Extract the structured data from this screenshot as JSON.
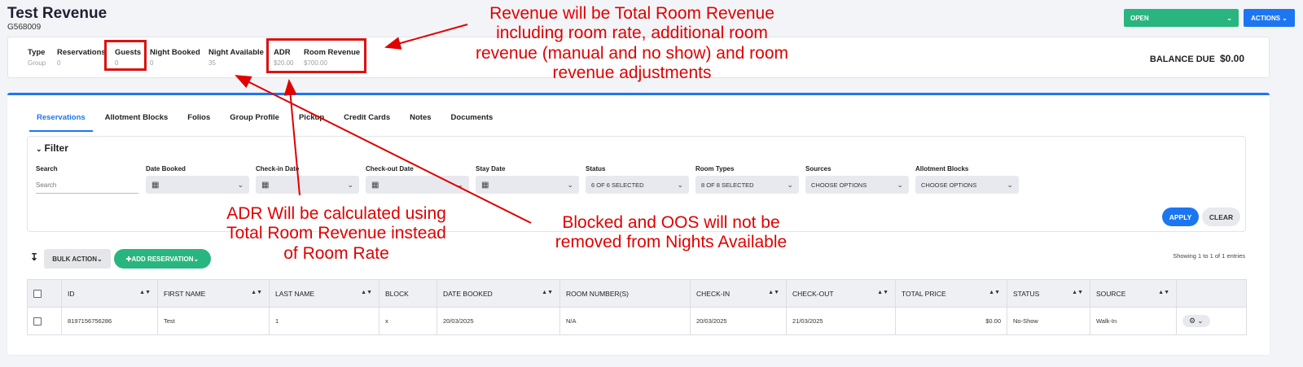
{
  "header": {
    "title": "Test Revenue",
    "code": "G568009",
    "status_button": "OPEN",
    "actions_button": "ACTIONS"
  },
  "stats": [
    {
      "label": "Type",
      "value": "Group"
    },
    {
      "label": "Reservations",
      "value": "0"
    },
    {
      "label": "Guests",
      "value": "0"
    },
    {
      "label": "Night Booked",
      "value": "0"
    },
    {
      "label": "Night Available",
      "value": "35"
    },
    {
      "label": "ADR",
      "value": "$20.00"
    },
    {
      "label": "Room Revenue",
      "value": "$700.00"
    }
  ],
  "balance": {
    "label": "BALANCE DUE",
    "value": "$0.00"
  },
  "tabs": [
    "Reservations",
    "Allotment Blocks",
    "Folios",
    "Group Profile",
    "Pickup",
    "Credit Cards",
    "Notes",
    "Documents"
  ],
  "filter": {
    "title": "Filter",
    "search_label": "Search",
    "search_placeholder": "Search",
    "fields": [
      {
        "label": "Date Booked",
        "value": ""
      },
      {
        "label": "Check-in Date",
        "value": ""
      },
      {
        "label": "Check-out Date",
        "value": ""
      },
      {
        "label": "Stay Date",
        "value": ""
      },
      {
        "label": "Status",
        "value": "6 OF 6 SELECTED"
      },
      {
        "label": "Room Types",
        "value": "8 OF 8 SELECTED"
      },
      {
        "label": "Sources",
        "value": "CHOOSE OPTIONS"
      },
      {
        "label": "Allotment Blocks",
        "value": "CHOOSE OPTIONS"
      }
    ],
    "apply": "APPLY",
    "clear": "CLEAR"
  },
  "toolbar": {
    "bulk_action": "BULK ACTION",
    "add_reservation": "ADD RESERVATION",
    "showing": "Showing 1 to 1 of 1 entries"
  },
  "table": {
    "columns": [
      "ID",
      "FIRST NAME",
      "LAST NAME",
      "BLOCK",
      "DATE BOOKED",
      "ROOM NUMBER(S)",
      "CHECK-IN",
      "CHECK-OUT",
      "TOTAL PRICE",
      "STATUS",
      "SOURCE"
    ],
    "rows": [
      {
        "id": "8197156756286",
        "first_name": "Test",
        "last_name": "1",
        "block": "x",
        "date_booked": "20/03/2025",
        "rooms": "N/A",
        "check_in": "20/03/2025",
        "check_out": "21/03/2025",
        "total_price": "$0.00",
        "status": "No-Show",
        "source": "Walk-In"
      }
    ]
  },
  "annotations": {
    "revenue": "Revenue will be Total Room Revenue including room rate, additional room revenue (manual and no show) and room revenue adjustments",
    "adr": "ADR Will be calculated using Total Room Revenue instead of Room Rate",
    "blocked": "Blocked and OOS will not be removed from Nights Available"
  },
  "colors": {
    "accent": "#1c76f2",
    "green": "#29b57f",
    "annotation": "#e00000"
  }
}
